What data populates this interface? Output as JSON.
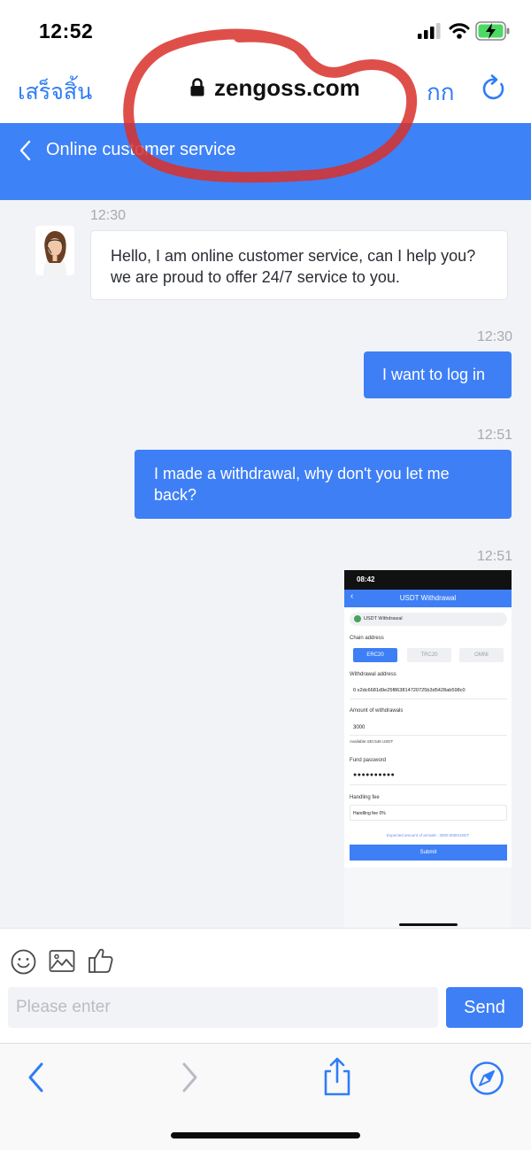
{
  "status_bar": {
    "time": "12:52"
  },
  "browser": {
    "done_label": "เสร็จสิ้น",
    "url": "zengoss.com",
    "reader_label": "กก",
    "icons": [
      "lock-icon",
      "reload-icon"
    ],
    "annotation_color": "#d9302a"
  },
  "header": {
    "title": "Online customer service",
    "color": "#3e82f7"
  },
  "chat": {
    "messages": [
      {
        "sender": "agent",
        "time": "12:30",
        "text": "Hello, I am online customer service, can I help you? we are proud to offer 24/7 service to you."
      },
      {
        "sender": "user",
        "time": "12:30",
        "text": "I want to log in"
      },
      {
        "sender": "user",
        "time": "12:51",
        "text": "I made a withdrawal, why don't you let me back?"
      },
      {
        "sender": "user",
        "time": "12:51",
        "type": "image"
      }
    ]
  },
  "attachment": {
    "status_time": "08:42",
    "title": "USDT Withdrawal",
    "tab_label": "USDT Withdrawal",
    "chain_label": "Chain address",
    "chains": [
      "ERC20",
      "TRC20",
      "OMNI"
    ],
    "selected_chain": "ERC20",
    "address_label": "Withdrawal address",
    "address_value": "0 x2dc6681d9e25f863814720725b3d5428ab598c0",
    "amount_label": "Amount of withdrawals",
    "amount_value": "3000",
    "available": "Available:430.546 USDT",
    "password_label": "Fund password",
    "password_value": "●●●●●●●●●●",
    "fee_label": "Handling fee",
    "fee_value": "Handling fee 0%",
    "expected": "Expected amount of arrivals : 3000.0000USDT",
    "submit_label": "Submit"
  },
  "composer": {
    "placeholder": "Please enter",
    "send_label": "Send",
    "icons": [
      "emoji-icon",
      "image-icon",
      "like-icon"
    ]
  },
  "safari_toolbar": {
    "icons": [
      "back-icon",
      "forward-icon",
      "share-icon",
      "compass-icon"
    ],
    "accent": "#2f7df6"
  }
}
